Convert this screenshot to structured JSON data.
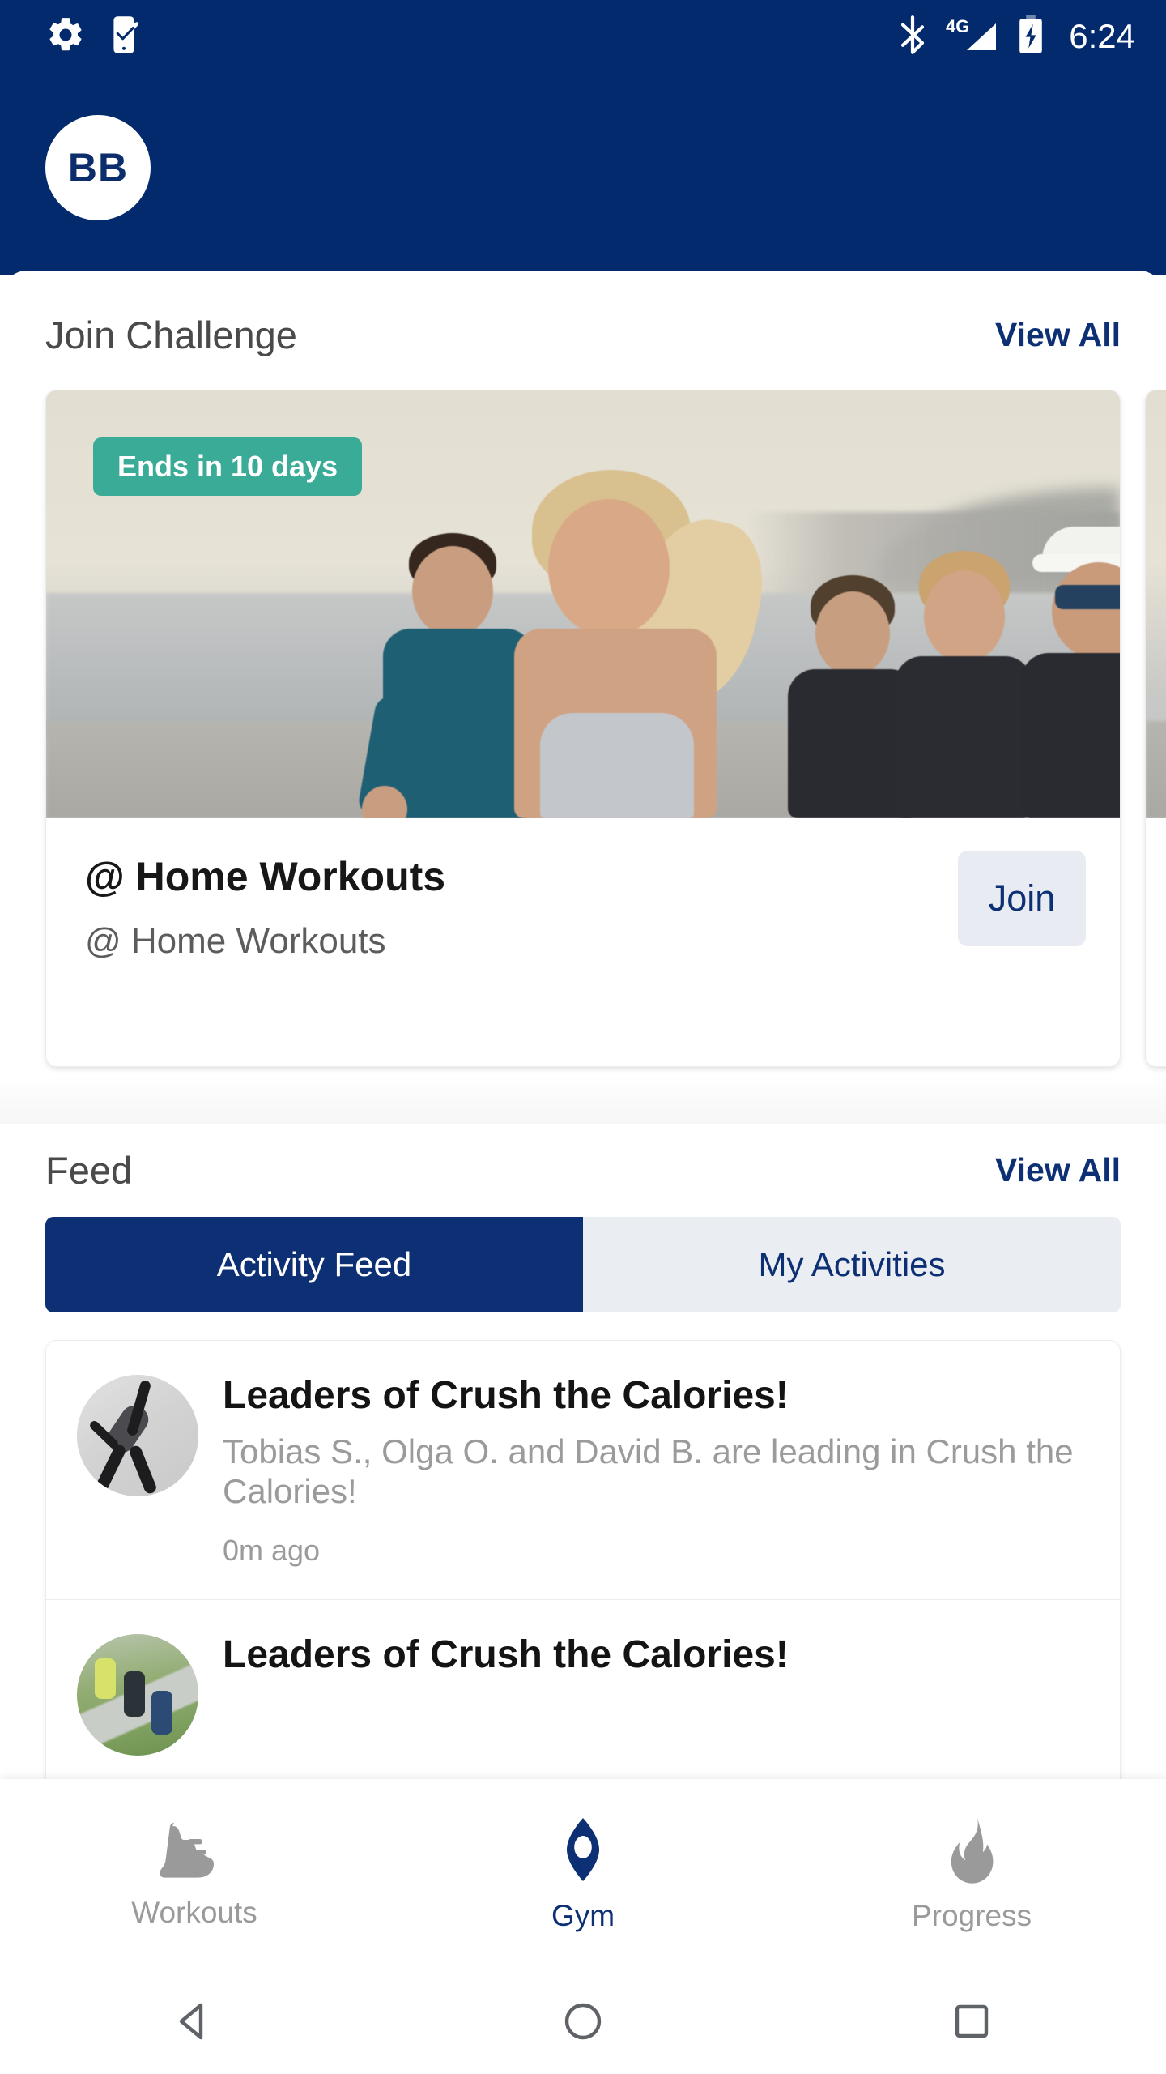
{
  "status_bar": {
    "time": "6:24",
    "icons": [
      "settings-gear-icon",
      "phone-check-icon",
      "bluetooth-icon",
      "signal-4g-icon",
      "battery-charging-icon"
    ],
    "network_label": "4G",
    "background_color": "#042a6e"
  },
  "header": {
    "avatar_initials": "BB",
    "background_color": "#042a6e"
  },
  "challenge_section": {
    "title": "Join Challenge",
    "view_all_label": "View All",
    "cards": [
      {
        "badge": "Ends in 10 days",
        "title": "@ Home Workouts",
        "subtitle": "@ Home Workouts",
        "action_label": "Join",
        "hero_alt": "group of people running along a beachfront"
      },
      {
        "badge": "",
        "title": "",
        "subtitle": "",
        "action_label": "",
        "hero_alt": "partially visible next challenge card"
      }
    ]
  },
  "feed_section": {
    "title": "Feed",
    "view_all_label": "View All",
    "tabs": [
      {
        "label": "Activity Feed",
        "active": true
      },
      {
        "label": "My Activities",
        "active": false
      }
    ],
    "items": [
      {
        "title": "Leaders of Crush the Calories!",
        "body": "Tobias S., Olga O. and David B. are leading in Crush the Calories!",
        "time": "0m ago",
        "avatar_alt": "person doing a yoga pose"
      },
      {
        "title": "Leaders of Crush the Calories!",
        "body": "",
        "time": "",
        "avatar_alt": "runners on an outdoor path"
      }
    ]
  },
  "bottom_nav": {
    "items": [
      {
        "label": "Workouts",
        "icon": "shoe-icon",
        "active": false
      },
      {
        "label": "Gym",
        "icon": "location-pin-icon",
        "active": true
      },
      {
        "label": "Progress",
        "icon": "flame-icon",
        "active": false
      }
    ],
    "active_color": "#0d2f74",
    "inactive_color": "#9a9a9a"
  },
  "system_nav": {
    "buttons": [
      "back-button",
      "home-button",
      "recents-button"
    ]
  },
  "theme": {
    "navy": "#042a6e",
    "navy_text": "#0d2f74",
    "teal_badge": "#3aab96",
    "chip_background": "#e8ecf2",
    "tab_inactive_background": "#eaedf2"
  }
}
